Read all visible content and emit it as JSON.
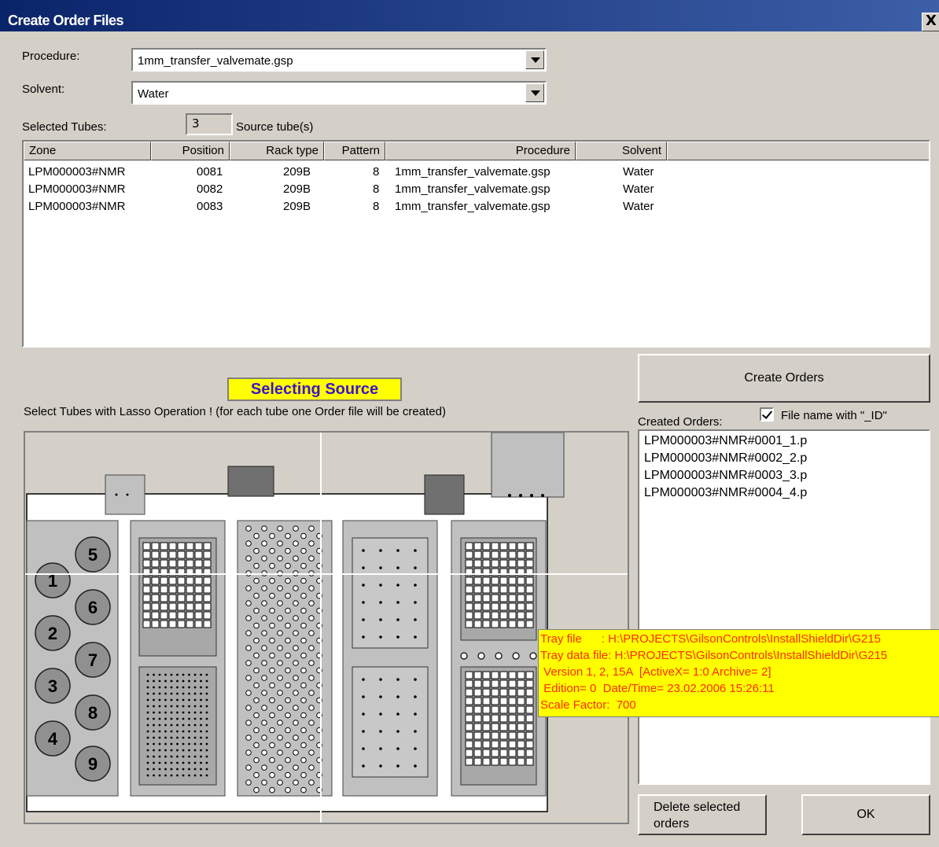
{
  "window": {
    "title": "Create Order Files",
    "close_glyph": "X"
  },
  "procedure": {
    "label": "Procedure:",
    "value": "1mm_transfer_valvemate.gsp"
  },
  "solvent": {
    "label": "Solvent:",
    "value": "Water"
  },
  "selected_tubes": {
    "label": "Selected Tubes:",
    "count": "3",
    "suffix": "Source tube(s)"
  },
  "table": {
    "columns": [
      "Zone",
      "Position",
      "Rack type",
      "Pattern",
      "Procedure",
      "Solvent"
    ],
    "rows": [
      [
        "LPM000003#NMR",
        "0081",
        "209B",
        "8",
        "1mm_transfer_valvemate.gsp",
        "Water"
      ],
      [
        "LPM000003#NMR",
        "0082",
        "209B",
        "8",
        "1mm_transfer_valvemate.gsp",
        "Water"
      ],
      [
        "LPM000003#NMR",
        "0083",
        "209B",
        "8",
        "1mm_transfer_valvemate.gsp",
        "Water"
      ]
    ]
  },
  "create_orders_button": "Create Orders",
  "status_banner": "Selecting Source",
  "instruction": "Select Tubes with Lasso Operation ! (for each tube one Order file will be created)",
  "created_orders": {
    "label": "Created Orders:",
    "checkbox_label": "File name with \"_ID\"",
    "checkbox_checked": true,
    "items": [
      "LPM000003#NMR#0001_1.p",
      "LPM000003#NMR#0002_2.p",
      "LPM000003#NMR#0003_3.p",
      "LPM000003#NMR#0004_4.p"
    ]
  },
  "delete_button": "Delete selected orders",
  "ok_button": "OK",
  "tooltip": {
    "lines": [
      "Tray file      : H:\\PROJECTS\\GilsonControls\\InstallShieldDir\\G215",
      "Tray data file: H:\\PROJECTS\\GilsonControls\\InstallShieldDir\\G215",
      " Version 1, 2, 15A  [ActiveX= 1:0 Archive= 2]",
      " Edition= 0  Date/Time= 23.02.2006 15:26:11",
      "Scale Factor:  700"
    ]
  },
  "tray": {
    "rack1_odd": [
      "1",
      "2",
      "3",
      "4"
    ],
    "rack1_even": [
      "5",
      "6",
      "7",
      "8",
      "9"
    ]
  },
  "colors": {
    "title_bar": "#0a246a",
    "dialog_bg": "#d4d0c8",
    "banner_bg": "#ffff00",
    "banner_text": "#3c14c8",
    "tooltip_text": "#ff2a00"
  }
}
